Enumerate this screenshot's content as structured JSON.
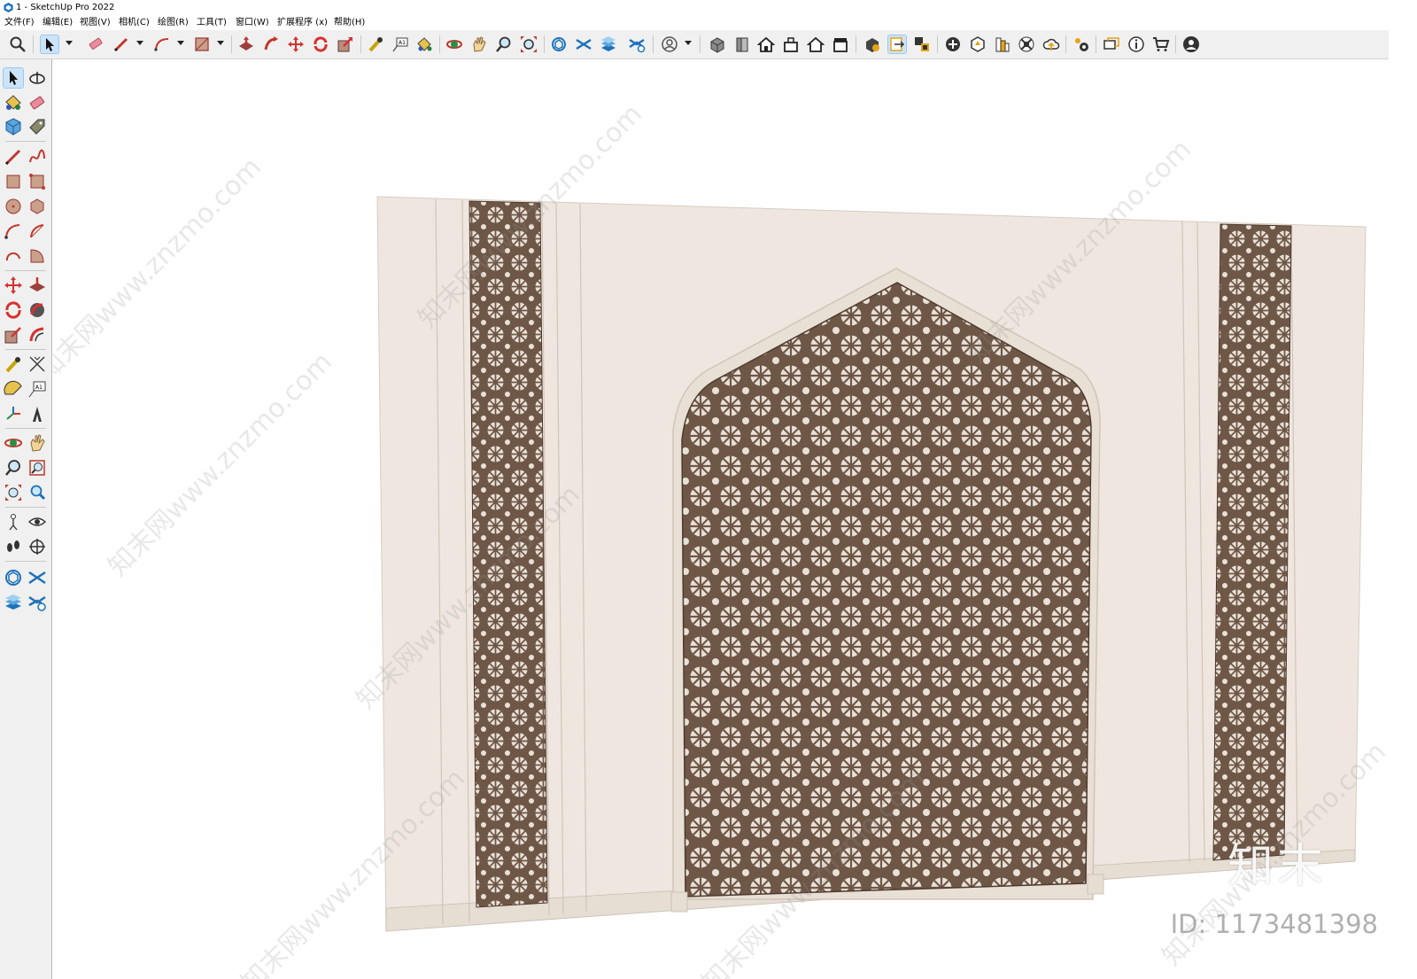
{
  "window": {
    "title": "1 - SketchUp Pro 2022"
  },
  "menu": [
    "文件(F)",
    "编辑(E)",
    "视图(V)",
    "相机(C)",
    "绘图(R)",
    "工具(T)",
    "窗口(W)",
    "扩展程序 (x)",
    "帮助(H)"
  ],
  "toolbar_icons": [
    "zoom-icon",
    "select-icon",
    "eraser-icon",
    "pencil-line-icon",
    "arc-icon",
    "rectangle-icon",
    "push-pull-icon",
    "follow-me-icon",
    "move-icon",
    "rotate-icon",
    "scale-icon",
    "tape-measure-icon",
    "text-icon",
    "paint-bucket-icon",
    "orbit-icon",
    "pan-icon",
    "zoom-tool-icon",
    "zoom-extents-icon",
    "warehouse-icon",
    "extension-warehouse-icon",
    "layout-icon",
    "extension-manager-icon",
    "profile-icon",
    "iso-view-icon",
    "top-view-icon",
    "front-view-icon",
    "right-view-icon",
    "back-view-icon",
    "left-view-icon",
    "section-plane-icon",
    "section-display-icon",
    "section-fill-icon",
    "add-location-icon",
    "sandbox-icon",
    "styles-icon",
    "components-icon",
    "cloud-icon",
    "settings-icon",
    "chat-icon",
    "info-icon",
    "cart-icon",
    "account-icon"
  ],
  "left_tools": [
    "select-icon",
    "orbit-icon",
    "paint-bucket-icon",
    "eraser-icon",
    "component-icon",
    "tag-icon",
    "pencil-icon",
    "freehand-icon",
    "rectangle-icon",
    "rotated-rect-icon",
    "circle-icon",
    "polygon-icon",
    "arc-icon",
    "pie-icon",
    "arc3-icon",
    "arc2-icon",
    "move-icon",
    "push-pull-icon",
    "rotate-icon",
    "follow-me-icon",
    "scale-icon",
    "offset-icon",
    "tape-icon",
    "dimension-icon",
    "protractor-icon",
    "text-icon",
    "axes-icon",
    "3d-text-icon",
    "orbit2-icon",
    "pan-icon",
    "zoom-icon",
    "zoom-window-icon",
    "zoom-extents-icon",
    "previous-view-icon",
    "position-camera-icon",
    "look-around-icon",
    "walk-icon",
    "section-icon",
    "warehouse-icon",
    "extension-icon",
    "layout-icon",
    "manager-icon"
  ],
  "watermark": {
    "site": "知末网www.znzmo.com",
    "brand": "知末",
    "id_label": "ID: 1173481398"
  },
  "colors": {
    "wall": "#efe7df",
    "lattice": "#6e5747",
    "toolbar_bg": "#f0f0f0",
    "active": "#cce4f7"
  }
}
